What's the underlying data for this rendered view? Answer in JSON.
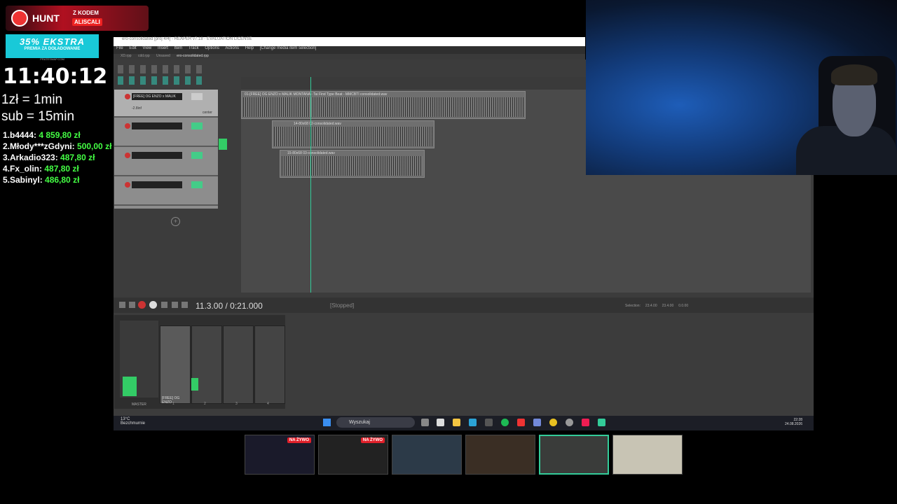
{
  "overlay": {
    "brand": "HUNT",
    "code_line1": "Z KODEM",
    "code_line2": "ALISCALI",
    "promo_big": "35% EKSTRA",
    "promo_small": "PREMIA ZA DOŁADOWANIE",
    "promo_site": "PRATESWAP.COM",
    "timer": "11:40:12",
    "rate1": "1zł = 1min",
    "rate2": "sub = 15min",
    "leaderboard": [
      {
        "rank_name": "1.b4444:",
        "amount": "4 859,80 zł"
      },
      {
        "rank_name": "2.Młody***zGdyni:",
        "amount": "500,00 zł"
      },
      {
        "rank_name": "3.Arkadio323:",
        "amount": "487,80 zł"
      },
      {
        "rank_name": "4.Fx_olin:",
        "amount": "487,80 zł"
      },
      {
        "rank_name": "5.Sabinyl:",
        "amount": "486,80 zł"
      }
    ]
  },
  "reaper": {
    "title": "ero-consolidated [proj 4/4] - REAPER v7.18 - EVALUATION LICENSE",
    "menu": [
      "File",
      "Edit",
      "View",
      "Insert",
      "Item",
      "Track",
      "Options",
      "Actions",
      "Help",
      "[Change media item selection]"
    ],
    "tabs": [
      "XD.rpp",
      "cdd.rpp",
      "Unsaved",
      "ero-consolidated.rpp"
    ],
    "tracks": [
      {
        "name": "[FREE] OG ENZO x MALIK",
        "vol": "-2.8inf",
        "extra": "center"
      },
      {
        "name": ""
      },
      {
        "name": ""
      },
      {
        "name": ""
      }
    ],
    "clips": [
      {
        "label": "01-[FREE] OG ENZO x MALIK MONTANA - Tai Find Type Beat - MMCBTI consolidated.wav"
      },
      {
        "label": "14-80x68 02-consolidated.wav"
      },
      {
        "label": "15-80x68 03-consolidated.wav"
      }
    ],
    "transport": {
      "time": "11.3.00 / 0:21.000",
      "status": "[Stopped]"
    },
    "selection": {
      "label": "Selection:",
      "start": "23.4.00",
      "end": "23.4.00",
      "length": "0.0.00"
    },
    "mixer": {
      "strip_name": "[FREE] OG ENZO",
      "master_label": "MASTER",
      "strip_numbers": [
        "1",
        "2",
        "3",
        "4"
      ]
    }
  },
  "taskbar": {
    "weather_temp": "13°C",
    "weather_text": "Bezchmurnie",
    "search_placeholder": "Wyszukaj",
    "time": "22:28",
    "date": "24.08.2026"
  },
  "thumbnails": [
    {
      "live": "NA ŻYWO"
    },
    {
      "live": "NA ŻYWO"
    },
    {
      "live": ""
    },
    {
      "live": ""
    },
    {
      "live": ""
    },
    {
      "live": ""
    }
  ]
}
